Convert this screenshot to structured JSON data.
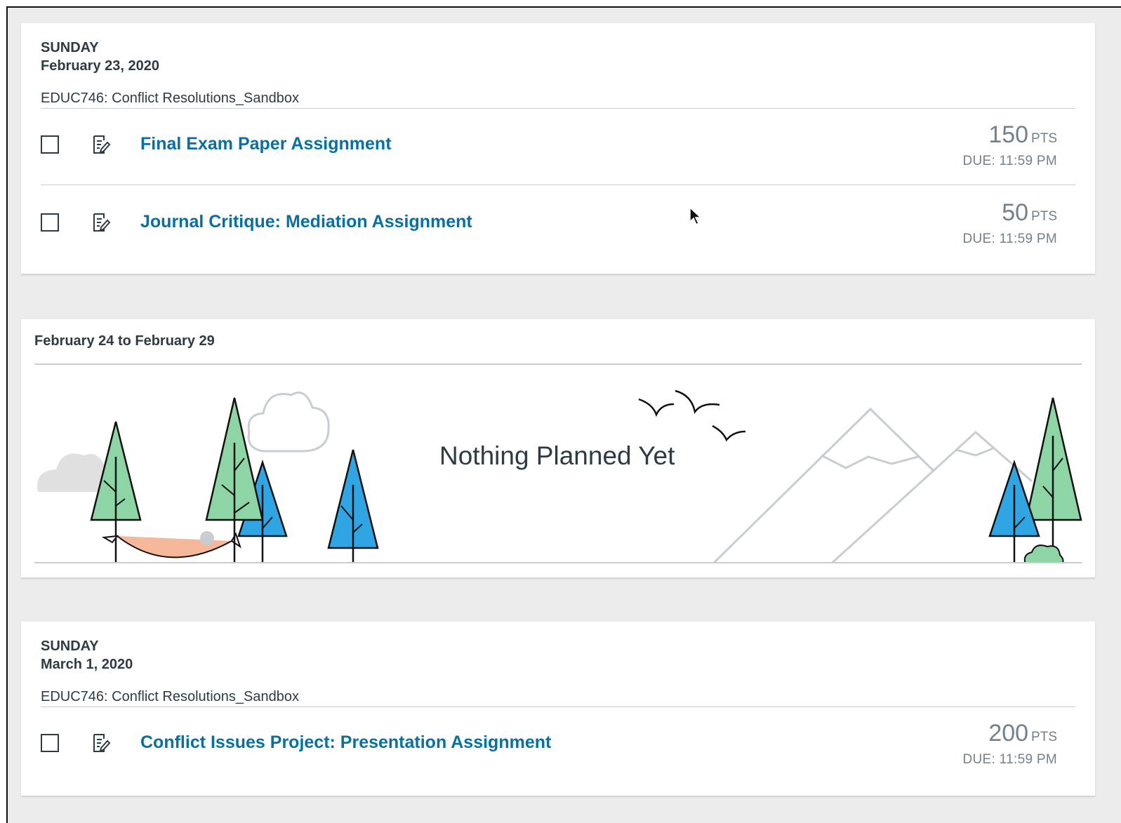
{
  "days": [
    {
      "day_name": "SUNDAY",
      "date": "February 23, 2020",
      "course": "EDUC746: Conflict Resolutions_Sandbox",
      "items": [
        {
          "title": "Final Exam Paper Assignment",
          "points": "150",
          "pts_label": "PTS",
          "due": "DUE: 11:59 PM",
          "type_icon": "assignment-icon"
        },
        {
          "title": "Journal Critique: Mediation Assignment",
          "points": "50",
          "pts_label": "PTS",
          "due": "DUE: 11:59 PM",
          "type_icon": "assignment-icon"
        }
      ]
    },
    {
      "day_name": "SUNDAY",
      "date": "March 1, 2020",
      "course": "EDUC746: Conflict Resolutions_Sandbox",
      "items": [
        {
          "title": "Conflict Issues Project: Presentation Assignment",
          "points": "200",
          "pts_label": "PTS",
          "due": "DUE: 11:59 PM",
          "type_icon": "assignment-icon"
        }
      ]
    }
  ],
  "empty_week": {
    "range": "February 24 to February 29",
    "message": "Nothing Planned Yet"
  },
  "colors": {
    "link": "#0770a3",
    "text": "#2d3b45",
    "muted": "#73818c",
    "tree_green": "#8ed5a5",
    "tree_blue": "#2fa6e3",
    "hammock": "#f6b89a",
    "background": "#ececec"
  }
}
